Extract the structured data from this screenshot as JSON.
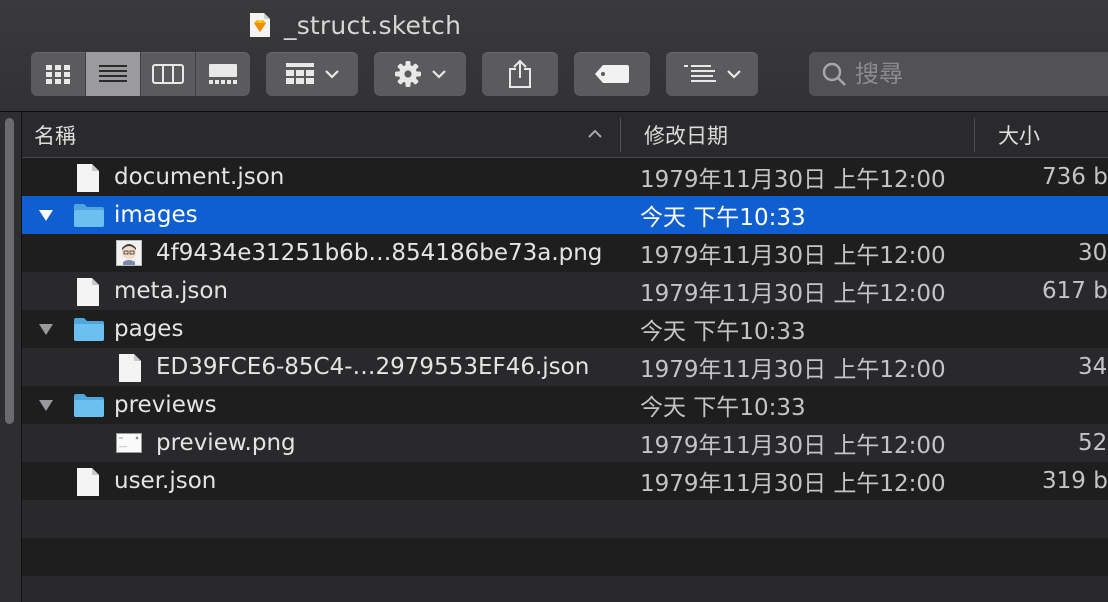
{
  "window": {
    "title": "_struct.sketch",
    "title_icon": "sketch-diamond-icon"
  },
  "toolbar": {
    "view_modes": [
      {
        "name": "icon-view",
        "icon": "grid-icon",
        "selected": false
      },
      {
        "name": "list-view",
        "icon": "list-icon",
        "selected": true
      },
      {
        "name": "column-view",
        "icon": "columns-icon",
        "selected": false
      },
      {
        "name": "gallery-view",
        "icon": "gallery-icon",
        "selected": false
      }
    ],
    "group_icon": "group-by-icon",
    "action_icon": "gear-icon",
    "share_icon": "share-icon",
    "tag_icon": "tag-icon",
    "arrange_icon": "arrange-icon"
  },
  "search": {
    "placeholder": "搜尋",
    "value": ""
  },
  "columns": {
    "name": "名稱",
    "date": "修改日期",
    "size": "大小"
  },
  "rows": [
    {
      "name": "document.json",
      "type": "file",
      "level": 0,
      "date": "1979年11月30日 上午12:00",
      "size": "736 b"
    },
    {
      "name": "images",
      "type": "folder",
      "level": 0,
      "expanded": true,
      "selected": true,
      "date": "今天 下午10:33",
      "size": ""
    },
    {
      "name": "4f9434e31251b6b…854186be73a.png",
      "type": "image",
      "level": 1,
      "date": "1979年11月30日 上午12:00",
      "size": "30"
    },
    {
      "name": "meta.json",
      "type": "file",
      "level": 0,
      "date": "1979年11月30日 上午12:00",
      "size": "617 b"
    },
    {
      "name": "pages",
      "type": "folder",
      "level": 0,
      "expanded": true,
      "date": "今天 下午10:33",
      "size": ""
    },
    {
      "name": "ED39FCE6-85C4-…2979553EF46.json",
      "type": "file",
      "level": 1,
      "date": "1979年11月30日 上午12:00",
      "size": "34"
    },
    {
      "name": "previews",
      "type": "folder",
      "level": 0,
      "expanded": true,
      "date": "今天 下午10:33",
      "size": ""
    },
    {
      "name": "preview.png",
      "type": "preview",
      "level": 1,
      "date": "1979年11月30日 上午12:00",
      "size": "52"
    },
    {
      "name": "user.json",
      "type": "file",
      "level": 0,
      "date": "1979年11月30日 上午12:00",
      "size": "319 b"
    }
  ],
  "colors": {
    "selection": "#0f5fd1",
    "folder": "#5fb7ec",
    "window": "#1e1e1e"
  }
}
